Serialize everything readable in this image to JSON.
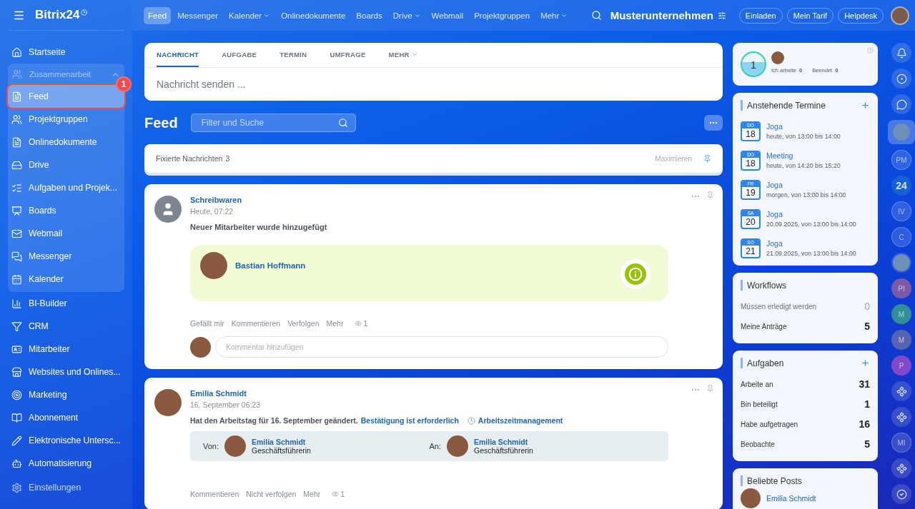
{
  "sidebar": {
    "brand": "Bitrix24",
    "items": [
      {
        "label": "Startseite",
        "selected": false
      },
      {
        "label": "Zusammenarbeit",
        "expanded": true,
        "children": [
          {
            "label": "Feed",
            "selected": true,
            "badge": "1"
          },
          {
            "label": "Projektgruppen",
            "selected": false
          },
          {
            "label": "Onlinedokumente",
            "selected": false
          },
          {
            "label": "Drive",
            "selected": false
          },
          {
            "label": "Aufgaben und Projek...",
            "selected": false
          },
          {
            "label": "Boards",
            "selected": false
          },
          {
            "label": "Webmail",
            "selected": false
          },
          {
            "label": "Messenger",
            "selected": false
          },
          {
            "label": "Kalender",
            "selected": false
          }
        ]
      },
      {
        "label": "BI-Builder",
        "selected": false
      },
      {
        "label": "CRM",
        "selected": false
      },
      {
        "label": "Mitarbeiter",
        "selected": false
      },
      {
        "label": "Websites und Onlines...",
        "selected": false
      },
      {
        "label": "Marketing",
        "selected": false
      },
      {
        "label": "Abonnement",
        "selected": false
      },
      {
        "label": "Elektronische Untersc...",
        "selected": false
      },
      {
        "label": "Automatisierung",
        "selected": false
      }
    ],
    "settings": "Einstellungen"
  },
  "topnav": {
    "tabs": [
      {
        "label": "Feed",
        "selected": true,
        "dropdown": false
      },
      {
        "label": "Messenger",
        "selected": false,
        "dropdown": false
      },
      {
        "label": "Kalender",
        "selected": false,
        "dropdown": true
      },
      {
        "label": "Onlinedokumente",
        "selected": false,
        "dropdown": false
      },
      {
        "label": "Boards",
        "selected": false,
        "dropdown": false
      },
      {
        "label": "Drive",
        "selected": false,
        "dropdown": true
      },
      {
        "label": "Webmail",
        "selected": false,
        "dropdown": false
      },
      {
        "label": "Projektgruppen",
        "selected": false,
        "dropdown": false
      },
      {
        "label": "Mehr",
        "selected": false,
        "dropdown": true
      }
    ],
    "company": "Musterunternehmen",
    "buttons": [
      "Einladen",
      "Mein Tarif",
      "Helpdesk"
    ]
  },
  "composer": {
    "tabs": [
      {
        "label": "NACHRICHT",
        "selected": true,
        "dropdown": false
      },
      {
        "label": "AUFGABE",
        "selected": false,
        "dropdown": false
      },
      {
        "label": "TERMIN",
        "selected": false,
        "dropdown": false
      },
      {
        "label": "UMFRAGE",
        "selected": false,
        "dropdown": false
      },
      {
        "label": "MEHR",
        "selected": false,
        "dropdown": true
      }
    ],
    "placeholder": "Nachricht senden ..."
  },
  "feed": {
    "title": "Feed",
    "search": {
      "placeholder": "Filter und Suche"
    },
    "pinned": {
      "label": "Fixierte Nachrichten",
      "count": "3",
      "action": "Maximieren"
    },
    "posts": [
      {
        "kind": "new_employee",
        "author": "Schreibwaren",
        "time": "Heute, 07:22",
        "text": "Neuer Mitarbeiter wurde hinzugefügt",
        "employee": "Bastian Hoffmann",
        "actions": [
          "Gefällt mir",
          "Kommentieren",
          "Verfolgen",
          "Mehr"
        ],
        "views": "1",
        "comment_placeholder": "Kommentar hinzufügen"
      },
      {
        "kind": "workday_change",
        "author": "Emilia Schmidt",
        "time": "16. September 06:23",
        "text": "Hat den Arbeitstag für 16. September geändert.",
        "link": "Bestätigung ist erforderlich",
        "module": "Arbeitszeitmanagement",
        "from": {
          "label": "Von:",
          "name": "Emilia Schmidt",
          "role": "Geschäftsführerin"
        },
        "to": {
          "label": "An:",
          "name": "Emilia Schmidt",
          "role": "Geschäftsführerin"
        },
        "actions": [
          "Kommentieren",
          "Nicht verfolgen",
          "Mehr"
        ],
        "views": "1"
      }
    ]
  },
  "right": {
    "worktime": {
      "counter": "1",
      "stats": [
        {
          "label": "Ich arbeite",
          "value": "0"
        },
        {
          "label": "Beendet",
          "value": "0"
        }
      ]
    },
    "events": {
      "title": "Anstehende Termine",
      "items": [
        {
          "day": "DO",
          "date": "18",
          "title": "Joga",
          "time": "heute, von 13:00 bis 14:00"
        },
        {
          "day": "DO",
          "date": "18",
          "title": "Meeting",
          "time": "heute, von 14:20 bis 15:20"
        },
        {
          "day": "FR",
          "date": "19",
          "title": "Joga",
          "time": "morgen, von 13:00 bis 14:00"
        },
        {
          "day": "SA",
          "date": "20",
          "title": "Joga",
          "time": "20.09.2025, von 13:00 bis 14:00"
        },
        {
          "day": "SO",
          "date": "21",
          "title": "Joga",
          "time": "21.09.2025, von 13:00 bis 14:00"
        }
      ]
    },
    "workflows": {
      "title": "Workflows",
      "rows": [
        {
          "label": "Müssen erledigt werden",
          "value": "0",
          "dimmed": true
        },
        {
          "label": "Meine Anträge",
          "value": "5",
          "dimmed": false
        }
      ]
    },
    "tasks": {
      "title": "Aufgaben",
      "rows": [
        {
          "label": "Arbeite an",
          "value": "31"
        },
        {
          "label": "Bin beteiligt",
          "value": "1"
        },
        {
          "label": "Habe aufgetragen",
          "value": "16"
        },
        {
          "label": "Beobachte",
          "value": "5"
        }
      ]
    },
    "popular": {
      "title": "Beliebte Posts",
      "items": [
        {
          "author": "Emilia Schmidt"
        }
      ]
    }
  },
  "rail": [
    {
      "kind": "icon"
    },
    {
      "kind": "icon"
    },
    {
      "kind": "icon"
    },
    {
      "kind": "avatar",
      "selected": true
    },
    {
      "kind": "initials",
      "label": "PM",
      "selected": false
    },
    {
      "kind": "logo",
      "label": "24",
      "selected": false
    },
    {
      "kind": "initials",
      "label": "IV",
      "selected": false
    },
    {
      "kind": "initials",
      "label": "C",
      "selected": false
    },
    {
      "kind": "avatar",
      "selected": false
    },
    {
      "kind": "initials",
      "label": "PI",
      "color": "#7c5aa8",
      "selected": false
    },
    {
      "kind": "initials",
      "label": "M",
      "color": "#2f8f95",
      "selected": false
    },
    {
      "kind": "initials",
      "label": "M",
      "color": "#5563b0",
      "selected": false
    },
    {
      "kind": "initials",
      "label": "P",
      "color": "#8149c9",
      "selected": false
    },
    {
      "kind": "icon"
    },
    {
      "kind": "icon"
    },
    {
      "kind": "initials",
      "label": "MI",
      "selected": false
    },
    {
      "kind": "icon"
    },
    {
      "kind": "icon"
    }
  ]
}
